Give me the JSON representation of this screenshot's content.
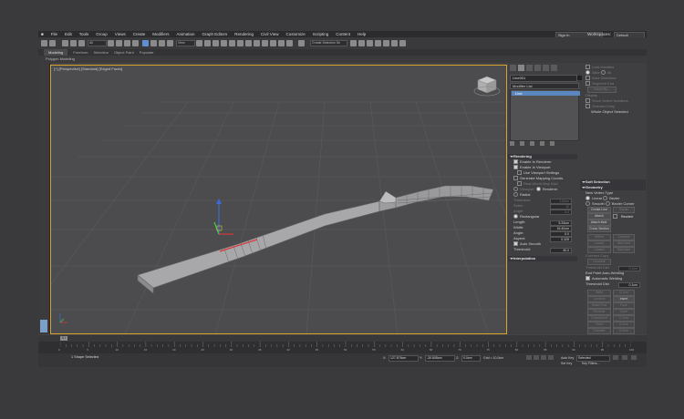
{
  "menu": {
    "items": [
      "File",
      "Edit",
      "Tools",
      "Group",
      "Views",
      "Create",
      "Modifiers",
      "Animation",
      "Graph Editors",
      "Rendering",
      "Civil View",
      "Customize",
      "Scripting",
      "Content",
      "Help"
    ],
    "signin_label": "Sign In",
    "workspaces_label": "Workspaces:",
    "workspace_value": "Default"
  },
  "toolbar": {
    "selection_filter": "All",
    "reference_coord": "View",
    "selection_set": "Create Selection Se"
  },
  "ribbon": {
    "tabs": [
      "Modeling",
      "Freeform",
      "Selection",
      "Object Paint",
      "Populate"
    ],
    "sub_label": "Polygon Modeling"
  },
  "viewport": {
    "label": "[+] [Perspective] [Standard] [Edged Faces]",
    "gizmo_colors": {
      "x": "#d43a3a",
      "y": "#3fcf3f",
      "z": "#3a6ad8"
    }
  },
  "command_panel": {
    "object_name": "Line001",
    "object_color": "#202020",
    "modifier_list": "Modifier List",
    "stack_items": [
      "Line"
    ],
    "rendering": {
      "title": "Rendering",
      "enable_in_renderer": "Enable In Renderer",
      "enable_in_viewport": "Enable In Viewport",
      "use_viewport_settings": "Use Viewport Settings",
      "generate_mapping": "Generate Mapping Coords.",
      "real_world": "Real-World Map Size",
      "viewport_opt": "Viewport",
      "renderer_opt": "Renderer",
      "radial": "Radial",
      "thickness": "Thickness:",
      "thickness_val": "1.0mm",
      "sides": "Sides:",
      "sides_val": "12",
      "angle": "Angle:",
      "angle_val": "0.0",
      "rectangular": "Rectangular",
      "length": "Length:",
      "length_val": "5.33cm",
      "width": "Width:",
      "width_val": "16.40cm",
      "angle2": "Angle:",
      "angle2_val": "0.0",
      "aspect": "Aspect:",
      "aspect_val": "0.325",
      "auto_smooth": "Auto Smooth",
      "threshold": "Threshold:",
      "threshold_val": "40.0"
    },
    "interpolation": "Interpolation",
    "selection_partial": {
      "use_soft": "Lock Handles",
      "alike": "Alike",
      "all": "All",
      "area_selection": "Area Selection:",
      "segment_end": "Segment End",
      "select_by": "Select By...",
      "display": "Display",
      "show_vertex_numbers": "Show Vertex Numbers",
      "selected_only": "Selected Only",
      "whole_object": "Whole Object Selected"
    },
    "soft_selection": "Soft Selection",
    "geometry": {
      "title": "Geometry",
      "new_vertex_type": "New Vertex Type",
      "linear": "Linear",
      "bezier": "Bezier",
      "smooth": "Smooth",
      "bezier_corner": "Bezier Corner",
      "create_line": "Create Line",
      "break": "Break",
      "attach": "Attach",
      "reorient": "Reorient",
      "attach_mult": "Attach Mult.",
      "cross_section": "Cross Section",
      "refine": "Refine",
      "connect": "Connect",
      "linear2": "Linear",
      "bind_first": "Bind first",
      "closed": "Closed",
      "bind_last": "Bind last",
      "connect_copy": "Connect Copy",
      "connect2": "Connect",
      "threshold": "Threshold Dist",
      "threshold_val": "0.1cm",
      "end_point_auto": "End Point Auto-Welding",
      "auto_welding": "Automatic Welding",
      "threshold2": "Threshold Dist",
      "threshold2_val": "0.1cm",
      "weld": "Weld",
      "weld_val": "0.1cm",
      "connect3": "Connect",
      "insert": "Insert",
      "make_first": "Make First",
      "fuse": "Fuse",
      "reverse": "Reverse",
      "cycle": "Cycle",
      "crossinsert": "CrossInsert",
      "crossinsert_val": "0.1cm",
      "fillet": "Fillet",
      "fillet_val": "0.0cm",
      "chamfer": "Chamfer",
      "chamfer_val": "0.0cm"
    }
  },
  "timeline": {
    "slider": "0 / 100",
    "tick_labels": [
      "0",
      "5",
      "10",
      "15",
      "20",
      "25",
      "30",
      "35",
      "40",
      "45",
      "50",
      "55",
      "60",
      "65",
      "70",
      "75",
      "80",
      "85",
      "90",
      "95",
      "100"
    ]
  },
  "status": {
    "selection": "1 Shape Selected",
    "x_label": "X:",
    "x": "127.876cm",
    "y_label": "Y:",
    "y": "-30.808cm",
    "z_label": "Z:",
    "z": "0.0cm",
    "grid": "Grid = 10.0cm",
    "auto_key": "Auto Key",
    "selected": "Selected",
    "set_key": "Set Key",
    "key_filters": "Key Filters..."
  }
}
